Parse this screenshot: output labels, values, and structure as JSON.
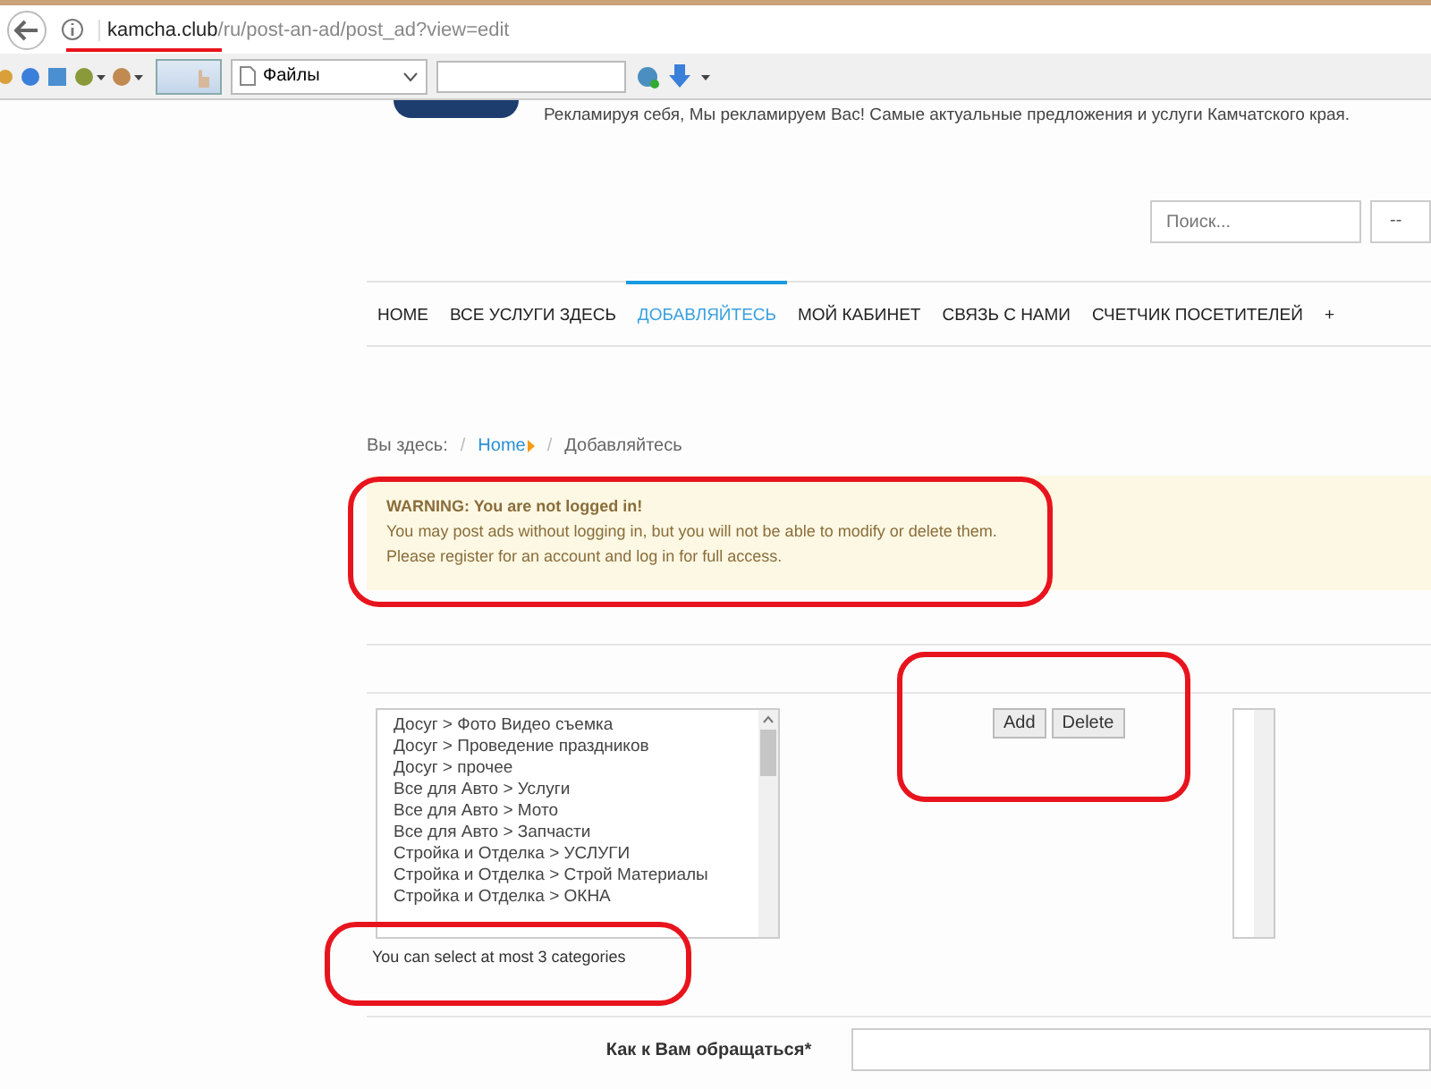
{
  "browser": {
    "url_host": "kamcha.club",
    "url_path": "/ru/post-an-ad/post_ad?view=edit",
    "toolbar_dropdown": "Файлы"
  },
  "site": {
    "tagline": "Рекламируя себя, Мы рекламируем Вас! Самые актуальные предложения и услуги Камчатского края.",
    "search_placeholder": "Поиск...",
    "search_select": "--"
  },
  "nav": [
    {
      "label": "HOME",
      "selected": false
    },
    {
      "label": "ВСЕ УСЛУГИ ЗДЕСЬ",
      "selected": false
    },
    {
      "label": "ДОБАВЛЯЙТЕСЬ",
      "selected": true
    },
    {
      "label": "МОЙ КАБИНЕТ",
      "selected": false
    },
    {
      "label": "СВЯЗЬ С НАМИ",
      "selected": false
    },
    {
      "label": "СЧЕТЧИК ПОСЕТИТЕЛЕЙ",
      "selected": false
    },
    {
      "label": "+",
      "selected": false
    }
  ],
  "breadcrumb": {
    "prefix": "Вы здесь:",
    "separator": "/",
    "items": [
      {
        "label": "Home",
        "kind": "link"
      },
      {
        "label": "Добавляйтесь",
        "kind": "current"
      }
    ]
  },
  "warning": {
    "title": "WARNING: You are not logged in!",
    "lines": [
      "You may post ads without logging in, but you will not be able to modify or delete them.",
      "Please register for an account and log in for full access."
    ]
  },
  "categories": {
    "options": [
      "Досуг > Фото Видео съемка",
      "Досуг > Проведение праздников",
      "Досуг > прочее",
      "Все для Авто > Услуги",
      "Все для Авто > Мото",
      "Все для Авто > Запчасти",
      "Стройка и Отделка > УСЛУГИ",
      "Стройка и Отделка > Строй Материалы",
      "Стройка и Отделка > ОКНА"
    ],
    "buttons": [
      "Add",
      "Delete"
    ],
    "hint": "You can select at most 3 categories"
  },
  "form": {
    "name_label": "Как к Вам обращаться*"
  }
}
